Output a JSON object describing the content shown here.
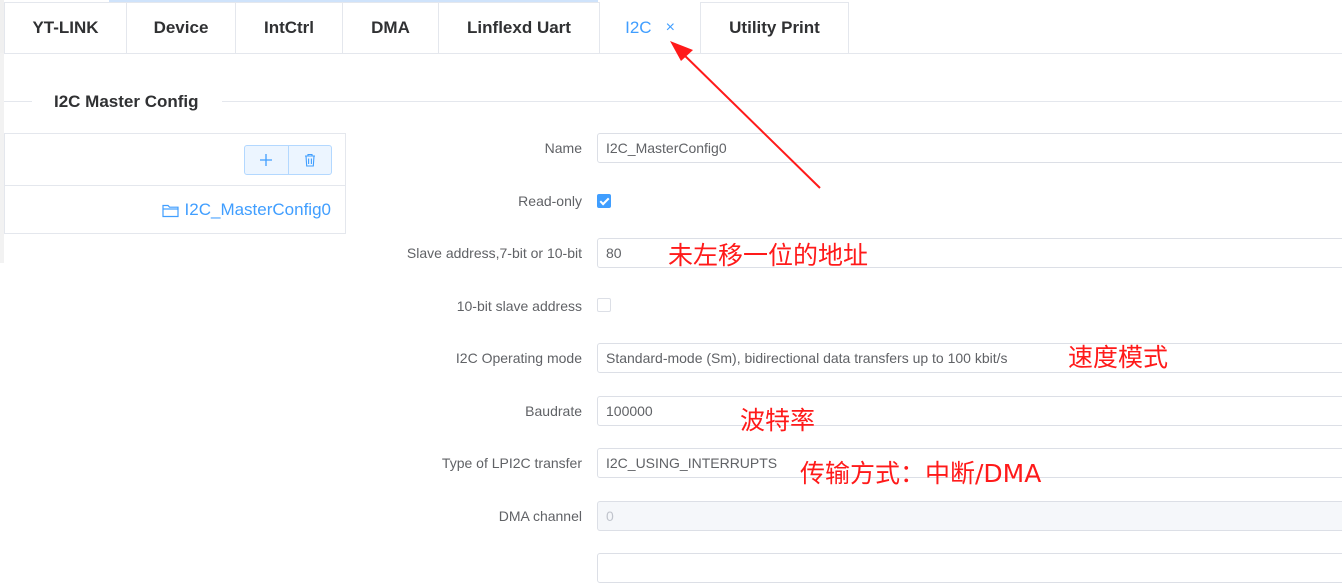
{
  "tabs": [
    {
      "label": "YT-LINK"
    },
    {
      "label": "Device"
    },
    {
      "label": "IntCtrl"
    },
    {
      "label": "DMA"
    },
    {
      "label": "Linflexd Uart"
    },
    {
      "label": "I2C",
      "close": "×"
    },
    {
      "label": "Utility Print"
    }
  ],
  "section": {
    "title": "I2C Master Config"
  },
  "list": {
    "items": [
      {
        "label": "I2C_MasterConfig0"
      }
    ]
  },
  "form": {
    "name_label": "Name",
    "name_value": "I2C_MasterConfig0",
    "readonly_label": "Read-only",
    "readonly_checked": true,
    "slave_address_label": "Slave address,7-bit or 10-bit",
    "slave_address_value": "80",
    "tenbit_label": "10-bit slave address",
    "tenbit_checked": false,
    "mode_label": "I2C Operating mode",
    "mode_value": "Standard-mode (Sm), bidirectional data transfers up to 100 kbit/s",
    "baudrate_label": "Baudrate",
    "baudrate_value": "100000",
    "transfer_label": "Type of LPI2C transfer",
    "transfer_value": "I2C_USING_INTERRUPTS",
    "dma_label": "DMA channel",
    "dma_value": "0"
  },
  "annotations": {
    "slave_address": "未左移一位的地址",
    "mode": "速度模式",
    "baudrate": "波特率",
    "transfer": "传输方式：中断/DMA"
  },
  "colors": {
    "accent": "#409eff",
    "annotation": "#ff1a1a"
  }
}
